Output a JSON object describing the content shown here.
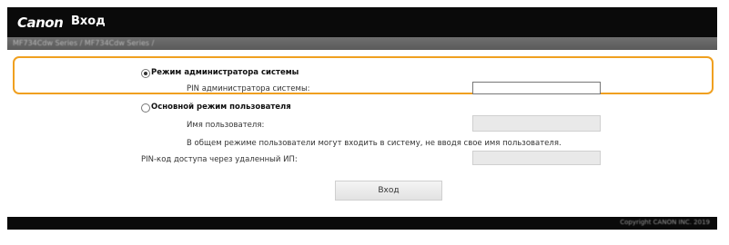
{
  "header": {
    "logo_text": "Canon",
    "title": "Вход"
  },
  "subheader": {
    "device_text": "MF734Cdw Series / MF734Cdw Series /"
  },
  "login": {
    "admin_mode": {
      "label": "Режим администратора системы",
      "selected": true,
      "pin_label": "PIN администратора системы:",
      "pin_value": ""
    },
    "user_mode": {
      "label": "Основной режим пользователя",
      "selected": false,
      "username_label": "Имя пользователя:",
      "username_value": "",
      "note": "В общем режиме пользователи могут входить в систему, не вводя свое имя пользователя."
    },
    "remote_pin": {
      "label": "PIN-код доступа через удаленный ИП:",
      "value": ""
    },
    "submit_label": "Вход"
  },
  "footer": {
    "copyright": "Copyright CANON INC. 2019"
  },
  "colors": {
    "header_bg": "#0a0a0a",
    "highlight": "#f0a020"
  }
}
